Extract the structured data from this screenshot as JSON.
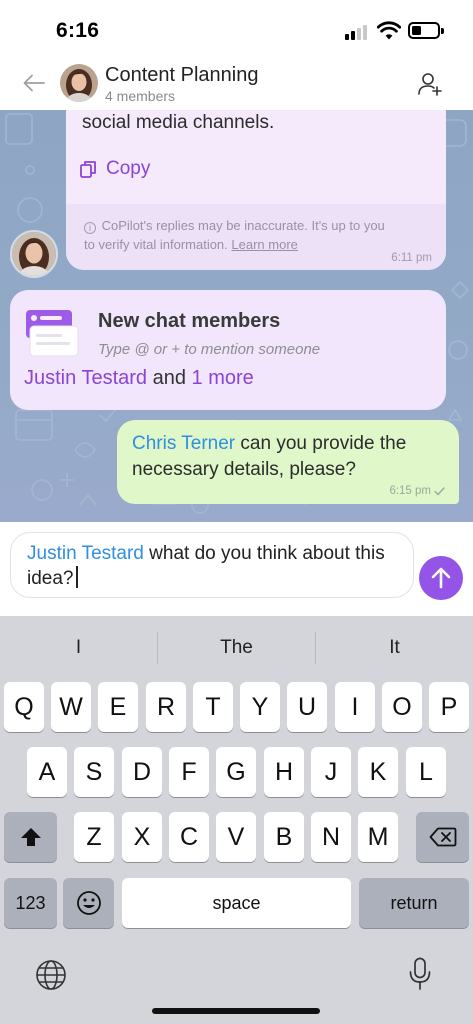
{
  "status_bar": {
    "time": "6:16"
  },
  "header": {
    "title": "Content Planning",
    "subtitle": "4 members",
    "back_icon": "arrow-left-icon",
    "add_member_icon": "person-add-icon"
  },
  "copilot_message": {
    "text": "social media channels.",
    "copy_label": "Copy",
    "disclaimer_line1": "CoPilot's replies may be inaccurate. It's up to you",
    "disclaimer_line2": "to verify vital information.",
    "learn_more": "Learn more",
    "time": "6:11 pm"
  },
  "members_card": {
    "title": "New chat members",
    "hint": "Type @ or + to mention someone",
    "mention": "Justin Testard",
    "connector": "and",
    "more": "1 more"
  },
  "my_message": {
    "mention": "Chris Terner",
    "text": "can you provide the necessary details, please?",
    "time": "6:15 pm"
  },
  "composer": {
    "mention": "Justin Testard",
    "text": "what do you think about this idea?"
  },
  "keyboard": {
    "suggestions": [
      "I",
      "The",
      "It"
    ],
    "row1": [
      "Q",
      "W",
      "E",
      "R",
      "T",
      "Y",
      "U",
      "I",
      "O",
      "P"
    ],
    "row2": [
      "A",
      "S",
      "D",
      "F",
      "G",
      "H",
      "J",
      "K",
      "L"
    ],
    "row3": [
      "Z",
      "X",
      "C",
      "V",
      "B",
      "N",
      "M"
    ],
    "numbers_label": "123",
    "space_label": "space",
    "return_label": "return"
  },
  "colors": {
    "accent_purple": "#9454e8",
    "mention_blue": "#2f8fe0",
    "outgoing_bubble": "#dff7c9",
    "incoming_bubble": "#f4eafb"
  }
}
